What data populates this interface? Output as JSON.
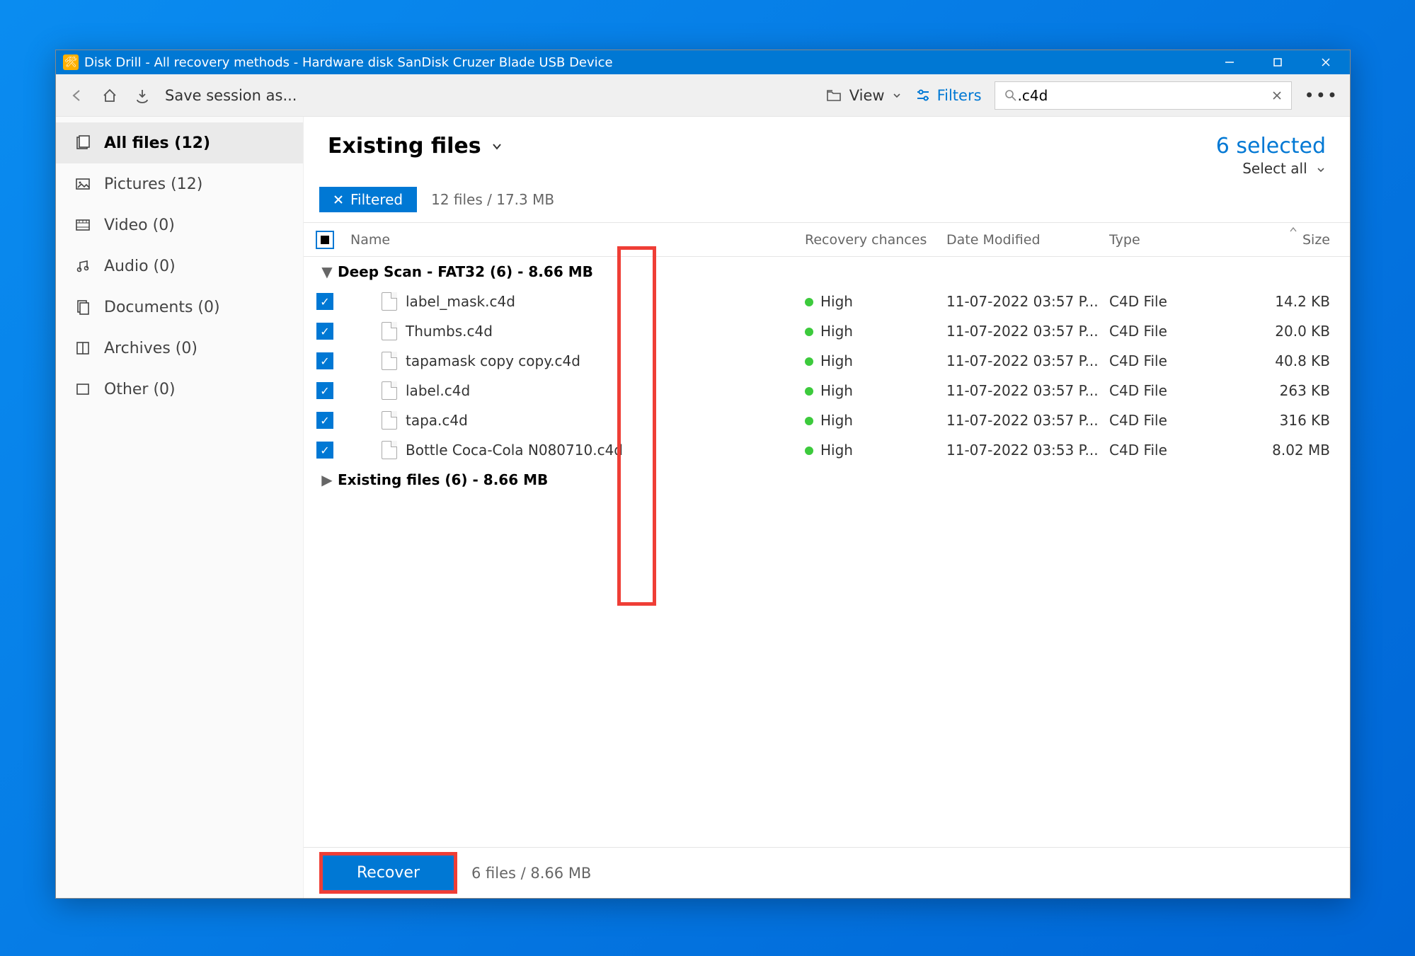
{
  "window_title": "Disk Drill - All recovery methods - Hardware disk SanDisk Cruzer Blade USB Device",
  "toolbar": {
    "save_session": "Save session as...",
    "view_label": "View",
    "filters_label": "Filters",
    "search_value": ".c4d"
  },
  "sidebar": [
    {
      "label": "All files (12)",
      "icon": "files"
    },
    {
      "label": "Pictures (12)",
      "icon": "pictures"
    },
    {
      "label": "Video (0)",
      "icon": "video"
    },
    {
      "label": "Audio (0)",
      "icon": "audio"
    },
    {
      "label": "Documents (0)",
      "icon": "documents"
    },
    {
      "label": "Archives (0)",
      "icon": "archives"
    },
    {
      "label": "Other (0)",
      "icon": "other"
    }
  ],
  "main": {
    "title": "Existing files",
    "selected_text": "6 selected",
    "select_all": "Select all",
    "filtered_label": "Filtered",
    "filter_summary": "12 files / 17.3 MB"
  },
  "columns": {
    "name": "Name",
    "rc": "Recovery chances",
    "dm": "Date Modified",
    "type": "Type",
    "size": "Size"
  },
  "group1": "Deep Scan - FAT32 (6) - 8.66 MB",
  "group2": "Existing files (6) - 8.66 MB",
  "files": [
    {
      "name": "label_mask.c4d",
      "rc": "High",
      "dm": "11-07-2022 03:57 P...",
      "type": "C4D File",
      "size": "14.2 KB"
    },
    {
      "name": "Thumbs.c4d",
      "rc": "High",
      "dm": "11-07-2022 03:57 P...",
      "type": "C4D File",
      "size": "20.0 KB"
    },
    {
      "name": "tapamask copy copy.c4d",
      "rc": "High",
      "dm": "11-07-2022 03:57 P...",
      "type": "C4D File",
      "size": "40.8 KB"
    },
    {
      "name": "label.c4d",
      "rc": "High",
      "dm": "11-07-2022 03:57 P...",
      "type": "C4D File",
      "size": "263 KB"
    },
    {
      "name": "tapa.c4d",
      "rc": "High",
      "dm": "11-07-2022 03:57 P...",
      "type": "C4D File",
      "size": "316 KB"
    },
    {
      "name": "Bottle Coca-Cola N080710.c4d",
      "rc": "High",
      "dm": "11-07-2022 03:53 P...",
      "type": "C4D File",
      "size": "8.02 MB"
    }
  ],
  "footer": {
    "recover": "Recover",
    "summary": "6 files / 8.66 MB"
  }
}
